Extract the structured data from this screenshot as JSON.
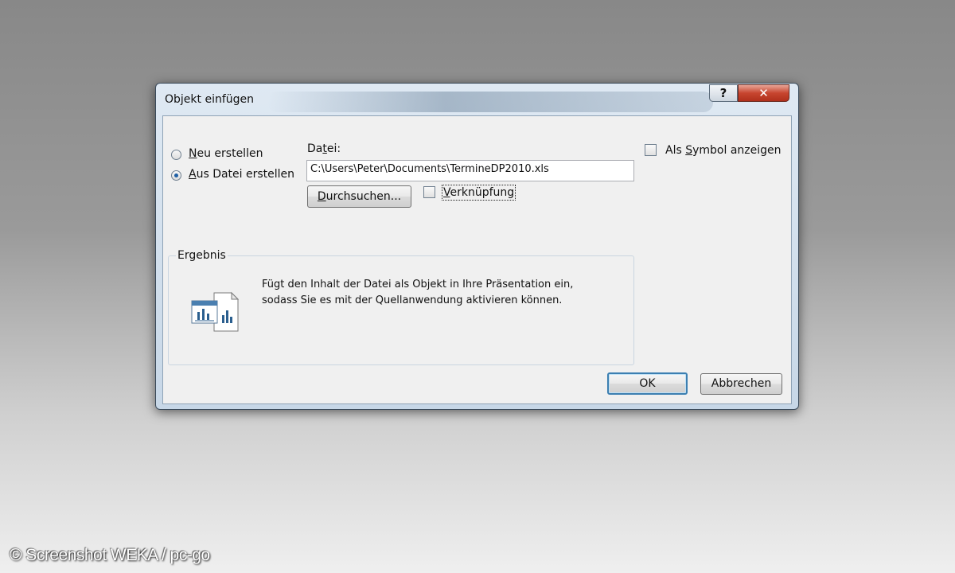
{
  "dialog": {
    "title": "Objekt einfügen",
    "help_label": "?",
    "close_label": "✕"
  },
  "options": {
    "neu_erstellen": {
      "label": "Neu erstellen",
      "checked": false
    },
    "aus_datei": {
      "label": "Aus Datei erstellen",
      "checked": true
    }
  },
  "file": {
    "label": "Datei:",
    "value": "C:\\Users\\Peter\\Documents\\TermineDP2010.xls",
    "browse_label": "Durchsuchen...",
    "link_label": "Verknüpfung",
    "link_checked": false
  },
  "display_as_icon": {
    "label": "Als Symbol anzeigen",
    "checked": false
  },
  "result": {
    "title": "Ergebnis",
    "line1": "Fügt den Inhalt der Datei als Objekt in Ihre Präsentation ein,",
    "line2": "sodass Sie es mit der Quellanwendung aktivieren können."
  },
  "buttons": {
    "ok_label": "OK",
    "cancel_label": "Abbrechen"
  },
  "watermark": "© Screenshot WEKA / pc-go",
  "colors": {
    "accent": "#3c7fb1",
    "close": "#c7452f",
    "radio_dot": "#1f5fa5"
  }
}
